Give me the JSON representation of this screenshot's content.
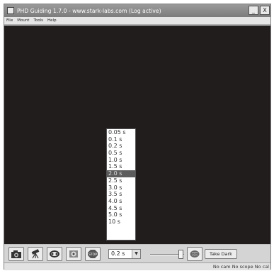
{
  "window": {
    "title": "PHD Guiding 1.7.0  -  www.stark-labs.com (Log active)",
    "minimize": "_",
    "close": "X"
  },
  "menu": [
    "File",
    "Mount",
    "Tools",
    "Help"
  ],
  "toolbar": {
    "buttons": [
      {
        "name": "camera-icon",
        "label": "Camera"
      },
      {
        "name": "telescope-icon",
        "label": "Telescope"
      },
      {
        "name": "loop-icon",
        "label": "Loop"
      },
      {
        "name": "guide-icon",
        "label": "Guide"
      },
      {
        "name": "stop-icon",
        "label": "STOP"
      }
    ],
    "exposure_value": "0.2 s",
    "take_dark_label": "Take Dark"
  },
  "exposure_options": [
    "0.05 s",
    "0.1 s",
    "0.2 s",
    "0.5 s",
    "1.0 s",
    "1.5 s",
    "2.0 s",
    "2.5 s",
    "3.0 s",
    "3.5 s",
    "4.0 s",
    "4.5 s",
    "5.0 s",
    "10 s"
  ],
  "highlighted_option": "2.0 s",
  "status": "No cam  No scope  No cal"
}
